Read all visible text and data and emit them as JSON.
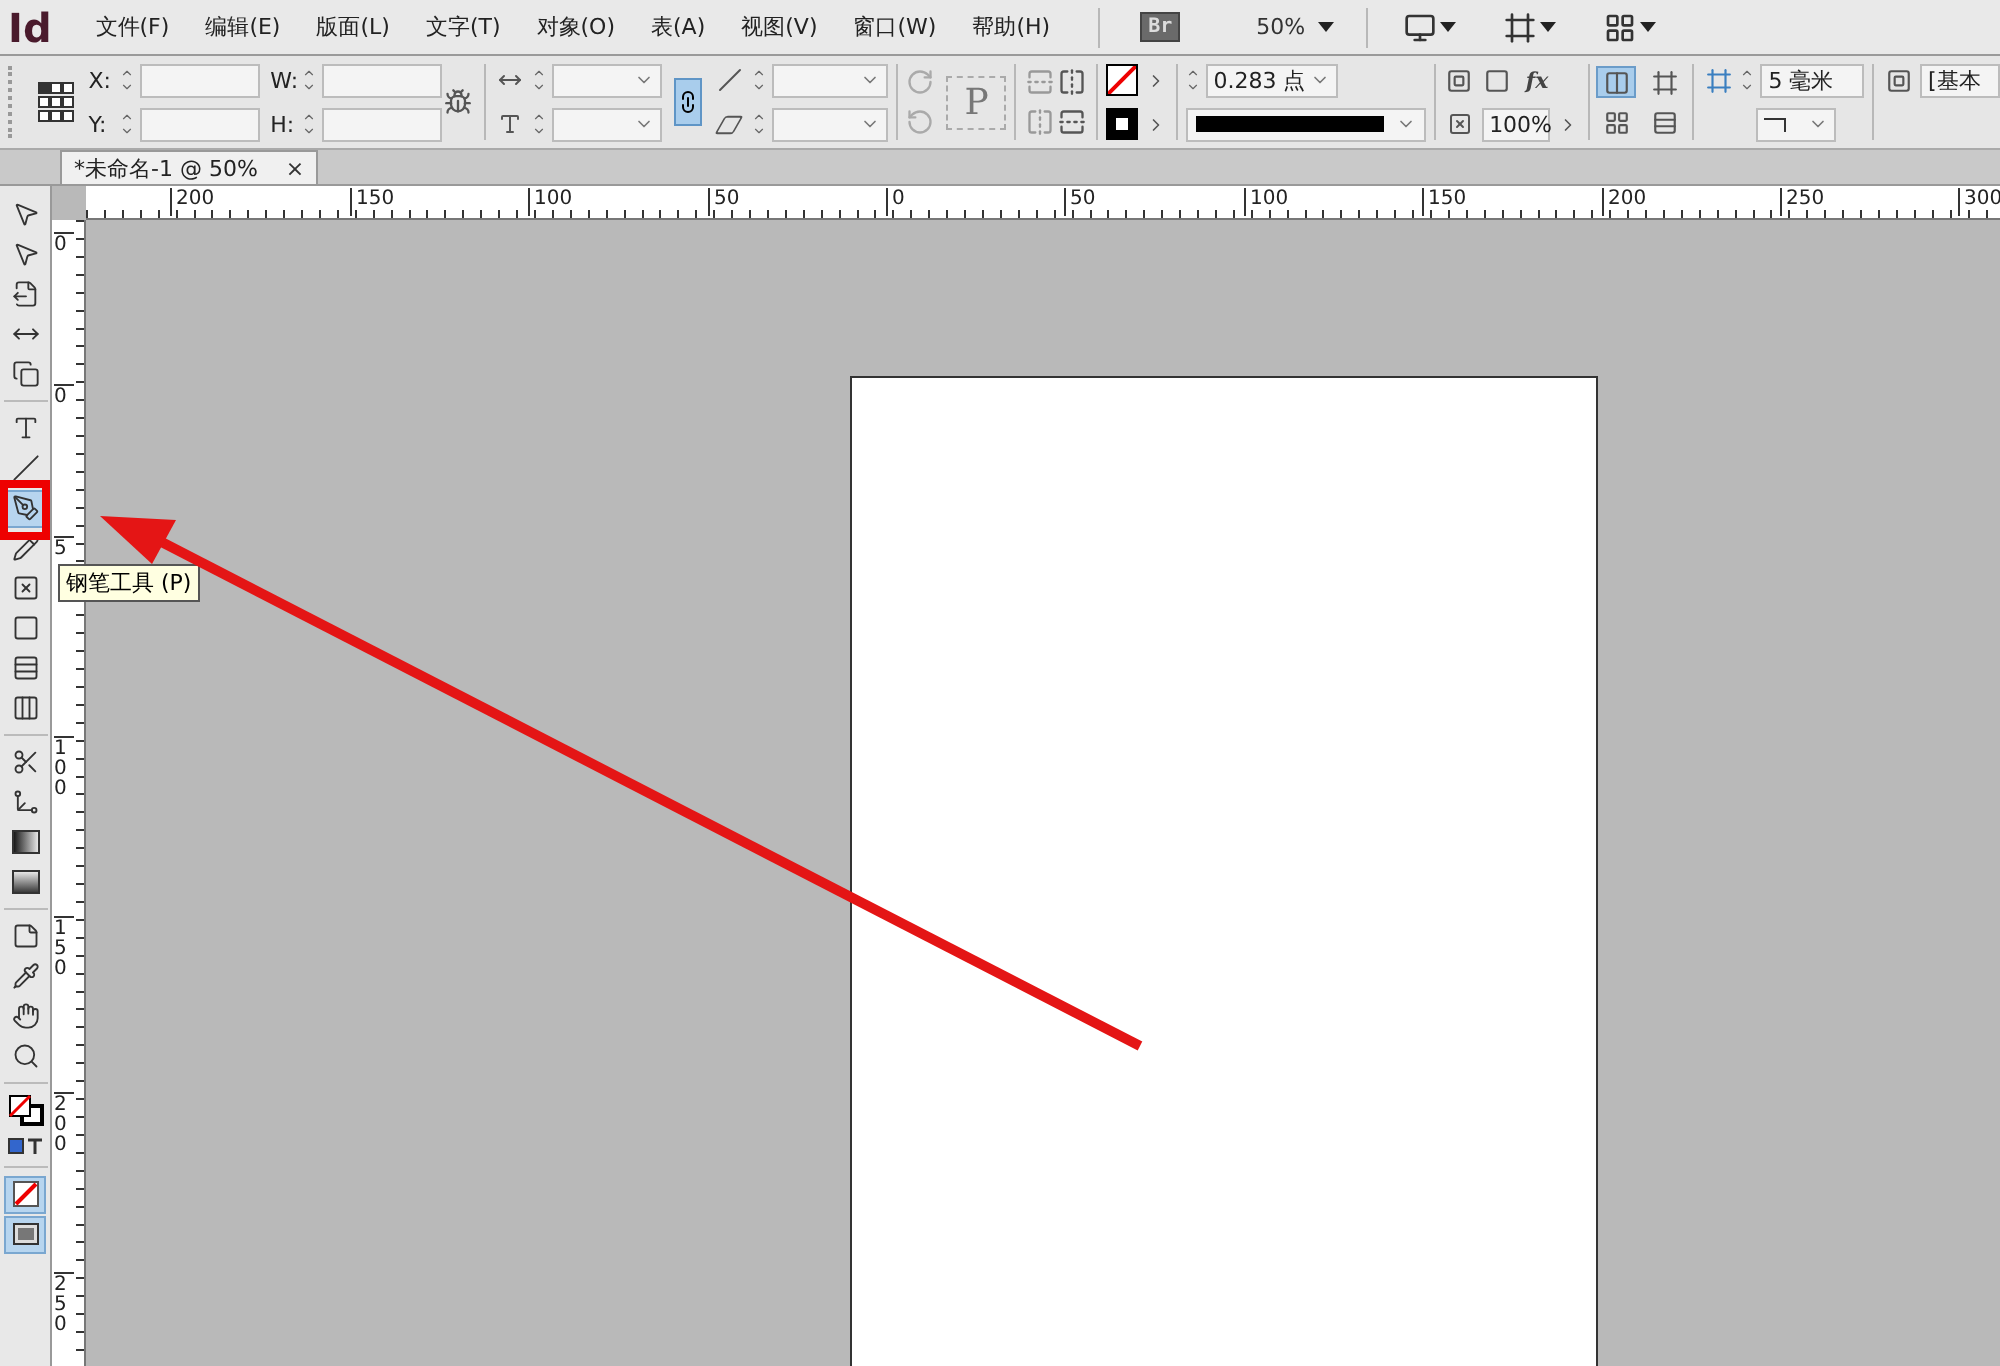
{
  "app_logo": "Id",
  "menus": [
    "文件(F)",
    "编辑(E)",
    "版面(L)",
    "文字(T)",
    "对象(O)",
    "表(A)",
    "视图(V)",
    "窗口(W)",
    "帮助(H)"
  ],
  "bridge_label": "Br",
  "zoom": "50%",
  "control_bar": {
    "x_label": "X:",
    "y_label": "Y:",
    "w_label": "W:",
    "h_label": "H:",
    "constrain_proportions": true,
    "text_frame_letter": "P",
    "effects_label": "fx",
    "stroke_weight": "0.283 点",
    "opacity": "100%",
    "spacing": "5 毫米",
    "object_style": "[基本",
    "stroke_align": [
      {
        "selected": true
      },
      {
        "selected": false
      },
      {
        "selected": false
      },
      {
        "selected": false
      }
    ]
  },
  "document_tab": {
    "title": "*未命名-1 @ 50%",
    "close": "×"
  },
  "horizontal_ruler": [
    "200",
    "150",
    "100",
    "50",
    "0",
    "50",
    "100",
    "150",
    "200",
    "250",
    "300"
  ],
  "vertical_ruler": [
    "0",
    "0",
    "5",
    "100",
    "150",
    "200",
    "250"
  ],
  "tools": [
    {
      "selected": false
    },
    {
      "selected": false
    },
    {
      "selected": false
    },
    {
      "selected": false
    },
    {
      "selected": false
    },
    {
      "selected": false
    },
    {
      "selected": false
    },
    {
      "selected": true
    },
    {
      "selected": false
    },
    {
      "selected": false
    },
    {
      "selected": false
    },
    {
      "selected": false
    },
    {
      "selected": false
    },
    {
      "selected": false
    },
    {
      "selected": false
    },
    {
      "selected": false
    },
    {
      "selected": false
    },
    {
      "selected": false
    },
    {
      "selected": false
    },
    {
      "selected": false
    },
    {
      "selected": false
    },
    {
      "selected": false
    },
    {
      "selected": false
    },
    {
      "selected": true
    },
    {
      "selected": true
    }
  ],
  "tooltip": "钢笔工具 (P)"
}
